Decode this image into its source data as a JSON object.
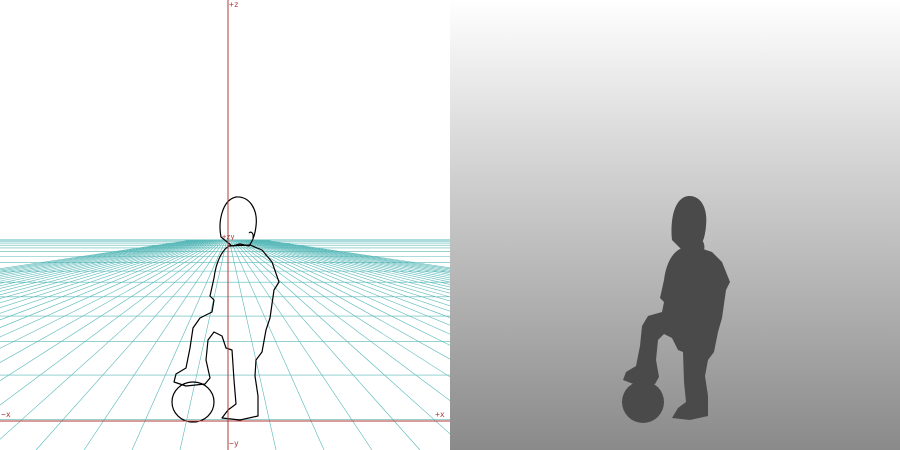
{
  "viewport_left": {
    "axis_labels": {
      "plus_z": "+z",
      "minus_x": "−x",
      "plus_x": "+x",
      "minus_y": "−y",
      "origin": "+zy"
    },
    "grid_color": "#58b8b8",
    "axis_color": "#b03a3a",
    "outline_color": "#000000",
    "subject": "child-with-soccer-ball-outline"
  },
  "viewport_right": {
    "background_gradient": [
      "#ffffff",
      "#8a8a8a"
    ],
    "silhouette_color": "#4a4a4a",
    "subject": "child-with-soccer-ball-silhouette"
  }
}
